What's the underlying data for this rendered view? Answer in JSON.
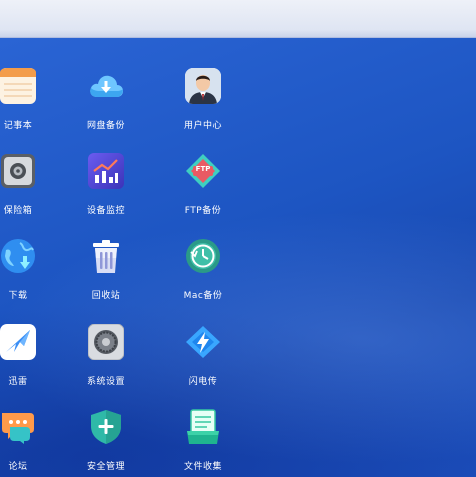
{
  "desktop": {
    "apps": [
      {
        "id": "notepad",
        "label": "记事本",
        "icon": "notepad-icon"
      },
      {
        "id": "net-backup",
        "label": "网盘备份",
        "icon": "cloud-download-icon"
      },
      {
        "id": "user-center",
        "label": "用户中心",
        "icon": "user-avatar-icon"
      },
      {
        "id": "safe",
        "label": "保险箱",
        "icon": "safe-icon"
      },
      {
        "id": "device-monitor",
        "label": "设备监控",
        "icon": "chart-trend-icon"
      },
      {
        "id": "ftp-backup",
        "label": "FTP备份",
        "icon": "ftp-icon"
      },
      {
        "id": "download",
        "label": "下载",
        "icon": "globe-download-icon"
      },
      {
        "id": "recycle-bin",
        "label": "回收站",
        "icon": "trash-icon"
      },
      {
        "id": "mac-backup",
        "label": "Mac备份",
        "icon": "time-machine-icon"
      },
      {
        "id": "xunlei",
        "label": "迅雷",
        "icon": "bird-icon"
      },
      {
        "id": "system-settings",
        "label": "系统设置",
        "icon": "gear-icon"
      },
      {
        "id": "flash-transfer",
        "label": "闪电传",
        "icon": "lightning-icon"
      },
      {
        "id": "forum",
        "label": "论坛",
        "icon": "chat-bubbles-icon"
      },
      {
        "id": "security-mgmt",
        "label": "安全管理",
        "icon": "shield-plus-icon"
      },
      {
        "id": "file-collect",
        "label": "文件收集",
        "icon": "document-stack-icon"
      }
    ]
  },
  "ftp_badge_text": "FTP"
}
